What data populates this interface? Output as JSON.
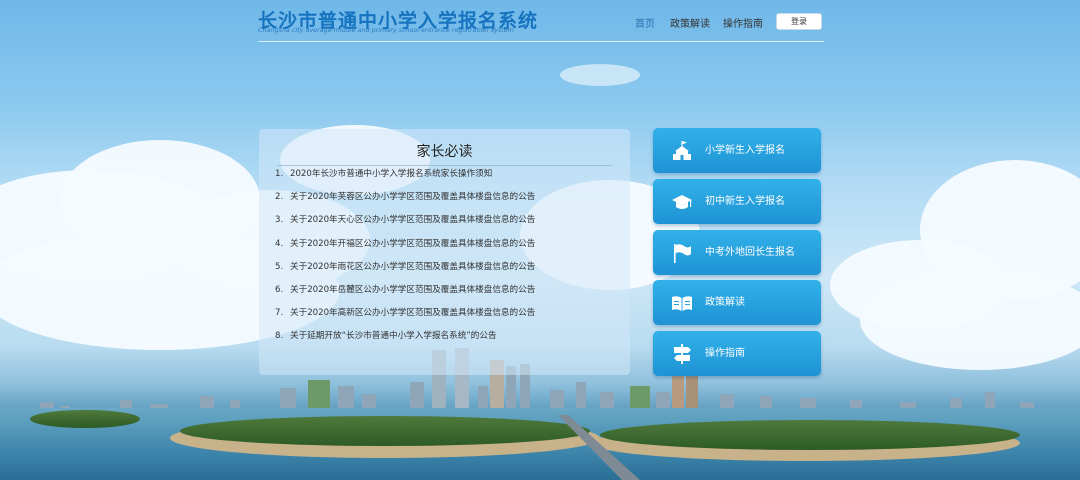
{
  "header": {
    "title": "长沙市普通中小学入学报名系统",
    "subtitle": "Changsha city average middle and primary school entrance registration system",
    "nav": [
      "首页",
      "政策解读",
      "操作指南"
    ],
    "login_label": "登录"
  },
  "notice": {
    "title": "家长必读",
    "items": [
      {
        "num": "1.",
        "text": "2020年长沙市普通中小学入学报名系统家长操作须知"
      },
      {
        "num": "2.",
        "text": "关于2020年芙蓉区公办小学学区范围及覆盖具体楼盘信息的公告"
      },
      {
        "num": "3.",
        "text": "关于2020年天心区公办小学学区范围及覆盖具体楼盘信息的公告"
      },
      {
        "num": "4.",
        "text": "关于2020年开福区公办小学学区范围及覆盖具体楼盘信息的公告"
      },
      {
        "num": "5.",
        "text": "关于2020年雨花区公办小学学区范围及覆盖具体楼盘信息的公告"
      },
      {
        "num": "6.",
        "text": "关于2020年岳麓区公办小学学区范围及覆盖具体楼盘信息的公告"
      },
      {
        "num": "7.",
        "text": "关于2020年高新区公办小学学区范围及覆盖具体楼盘信息的公告"
      },
      {
        "num": "8.",
        "text": "关于延期开放“长沙市普通中小学入学报名系统”的公告"
      }
    ]
  },
  "entries": [
    {
      "label": "小学新生入学报名",
      "icon": "school-building-icon"
    },
    {
      "label": "初中新生入学报名",
      "icon": "graduation-cap-icon"
    },
    {
      "label": "中考外地回长生报名",
      "icon": "flag-icon"
    },
    {
      "label": "政策解读",
      "icon": "open-book-icon"
    },
    {
      "label": "操作指南",
      "icon": "signpost-icon"
    }
  ],
  "colors": {
    "brand": "#1673c0",
    "button": "#2aa6e2",
    "panel": "#d2e8f8"
  }
}
